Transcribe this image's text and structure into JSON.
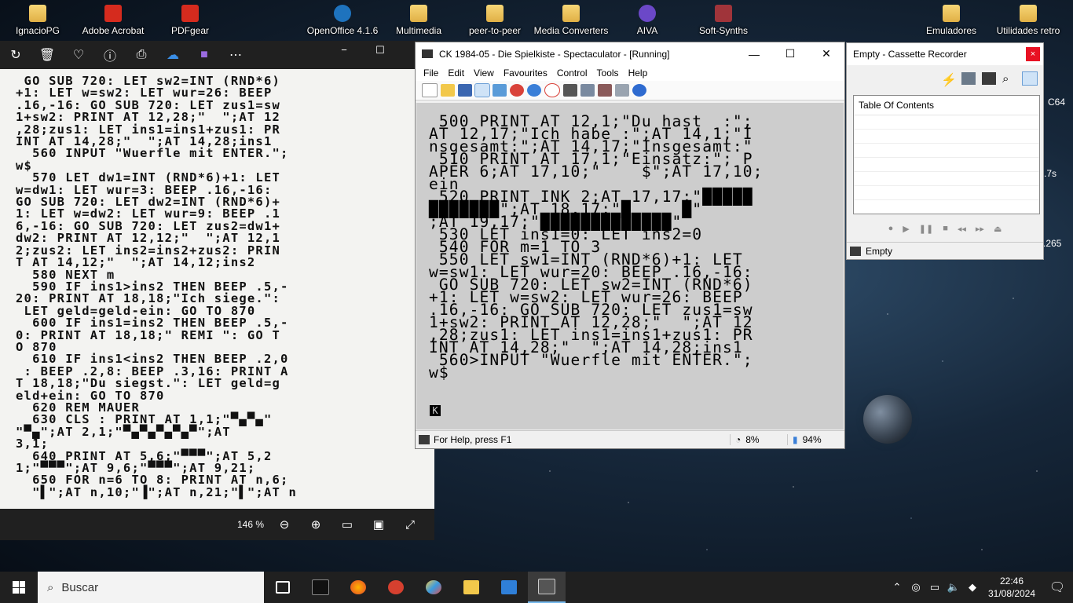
{
  "desktop": {
    "icons": [
      {
        "label": "IgnacioPG"
      },
      {
        "label": "Adobe Acrobat"
      },
      {
        "label": "PDFgear"
      },
      {
        "label": "OpenOffice 4.1.6"
      },
      {
        "label": "Multimedia"
      },
      {
        "label": "peer-to-peer"
      },
      {
        "label": "Media Converters"
      },
      {
        "label": "AIVA"
      },
      {
        "label": "Soft-Synths"
      },
      {
        "label": "Emuladores"
      },
      {
        "label": "Utilidades retro"
      }
    ],
    "side_labels": [
      "C64",
      ".7s",
      ".265"
    ]
  },
  "photo_viewer": {
    "toolbar": [
      "rotate-icon",
      "delete-icon",
      "favorite-icon",
      "info-icon",
      "print-icon",
      "onedrive-icon",
      "edit-icon",
      "more-icon"
    ],
    "caption": {
      "minimize": "−",
      "maximize": "☐"
    },
    "zoom": "146 %",
    "listing_lines": [
      " GO SUB 720: LET sw2=INT (RND*6)",
      "+1: LET w=sw2: LET wur=26: BEEP",
      ".16,-16: GO SUB 720: LET zus1=sw",
      "1+sw2: PRINT AT 12,28;\"  \";AT 12",
      ",28;zus1: LET ins1=ins1+zus1: PR",
      "INT AT 14,28;\"  \";AT 14,28;ins1",
      "  560 INPUT \"Wuerfle mit ENTER.\";",
      "w$",
      "  570 LET dw1=INT (RND*6)+1: LET",
      "w=dw1: LET wur=3: BEEP .16,-16:",
      "GO SUB 720: LET dw2=INT (RND*6)+",
      "1: LET w=dw2: LET wur=9: BEEP .1",
      "6,-16: GO SUB 720: LET zus2=dw1+",
      "dw2: PRINT AT 12,12;\"  \";AT 12,1",
      "2;zus2: LET ins2=ins2+zus2: PRIN",
      "T AT 14,12;\"  \";AT 14,12;ins2",
      "  580 NEXT m",
      "  590 IF ins1>ins2 THEN BEEP .5,-",
      "20: PRINT AT 18,18;\"Ich siege.\":",
      " LET geld=geld-ein: GO TO 870",
      "  600 IF ins1=ins2 THEN BEEP .5,-",
      "0: PRINT AT 18,18;\" REMI \": GO T",
      "O 870",
      "  610 IF ins1<ins2 THEN BEEP .2,0",
      " : BEEP .2,8: BEEP .3,16: PRINT A",
      "T 18,18;\"Du siegst.\": LET geld=g",
      "eld+ein: GO TO 870",
      "  620 REM MAUER",
      "  630 CLS : PRINT AT 1,1;\"▀▄▀▄\"",
      "\"▀▄\";AT 2,1;\"▀▄▀▄▀▄▀▄▀\";AT",
      "3,1;",
      "  640 PRINT AT 5,6;\"▀▀▀\";AT 5,2",
      "1;\"▀▀▀\";AT 9,6;\"▀▀▀\";AT 9,21;",
      "",
      "  650 FOR n=6 TO 8: PRINT AT n,6;",
      "  \"▌\";AT n,10;\"▐\";AT n,21;\"▌\";AT n"
    ],
    "bottom_buttons": [
      "zoom-out-icon",
      "zoom-in-icon",
      "fit-icon",
      "actual-size-icon",
      "fullscreen-icon"
    ]
  },
  "spectaculator": {
    "title": "CK 1984-05 - Die Spielkiste - Spectaculator - [Running]",
    "caption": {
      "minimize": "—",
      "maximize": "☐",
      "close": "✕"
    },
    "menu": [
      "File",
      "Edit",
      "View",
      "Favourites",
      "Control",
      "Tools",
      "Help"
    ],
    "screen_lines": [
      " 500 PRINT AT 12,1;\"Du hast  :\";",
      "AT 12,17;\"Ich habe :\";AT 14,1;\"I",
      "nsgesamt:\";AT 14,17;\"Insgesamt:\"",
      " 510 PRINT AT 17,1;\"Einsatz:\"; P",
      "APER 6;AT 17,10;\"    $\";AT 17,10;",
      "ein",
      " 520 PRINT INK 2;AT 17,17;\"█████",
      "███████\";AT 18,17;\"█     █\"",
      ";AT 19,17;\"█████████████\"",
      " 530 LET ins1=0: LET ins2=0",
      " 540 FOR m=1 TO 3",
      " 550 LET sw1=INT (RND*6)+1: LET",
      "w=sw1: LET wur=20: BEEP .16,-16:",
      " GO SUB 720: LET sw2=INT (RND*6)",
      "+1: LET w=sw2: LET wur=26: BEEP",
      ".16,-16: GO SUB 720: LET zus1=sw",
      "1+sw2: PRINT AT 12,28;\"  \";AT 12",
      ",28;zus1: LET ins1=ins1+zus1: PR",
      "INT AT 14,28;\"  \";AT 14,28;ins1",
      " 560>INPUT \"Wuerfle mit ENTER.\";",
      "w$"
    ],
    "cursor": "K",
    "status": {
      "help": "For Help, press F1",
      "cpu": "8%",
      "speed": "94%"
    }
  },
  "cassette": {
    "title": "Empty - Cassette Recorder",
    "close": "×",
    "toc_header": "Table Of Contents",
    "status": "Empty",
    "transport": [
      "●",
      "▶",
      "❚❚",
      "■",
      "◂◂",
      "▸▸",
      "⏏"
    ]
  },
  "taskbar": {
    "search_placeholder": "Buscar",
    "time": "22:46",
    "date": "31/08/2024",
    "apps": [
      "task-view-icon",
      "terminal-icon",
      "firefox-icon",
      "ccleaner-icon",
      "paint-icon",
      "file-explorer-icon",
      "photos-icon",
      "spectaculator-icon"
    ]
  },
  "colors": {
    "zx_screen": "#cdcdcd",
    "taskbar": "#202020",
    "viewer": "#202020",
    "close_red": "#e81123"
  }
}
